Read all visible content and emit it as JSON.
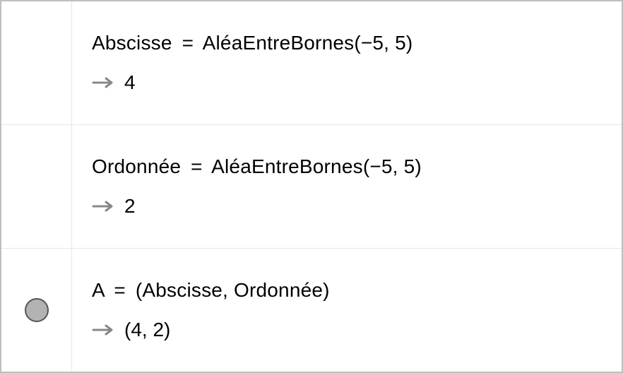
{
  "rows": [
    {
      "lhs": "Abscisse",
      "rhs_fn": "AléaEntreBornes",
      "rhs_args": "(−5, 5)",
      "output": "4",
      "marker": null
    },
    {
      "lhs": "Ordonnée",
      "rhs_fn": "AléaEntreBornes",
      "rhs_args": "(−5, 5)",
      "output": "2",
      "marker": null
    },
    {
      "lhs": "A",
      "rhs_fn": "",
      "rhs_args": "(Abscisse, Ordonnée)",
      "output": "(4, 2)",
      "marker": "point"
    }
  ],
  "symbols": {
    "equals": "="
  }
}
